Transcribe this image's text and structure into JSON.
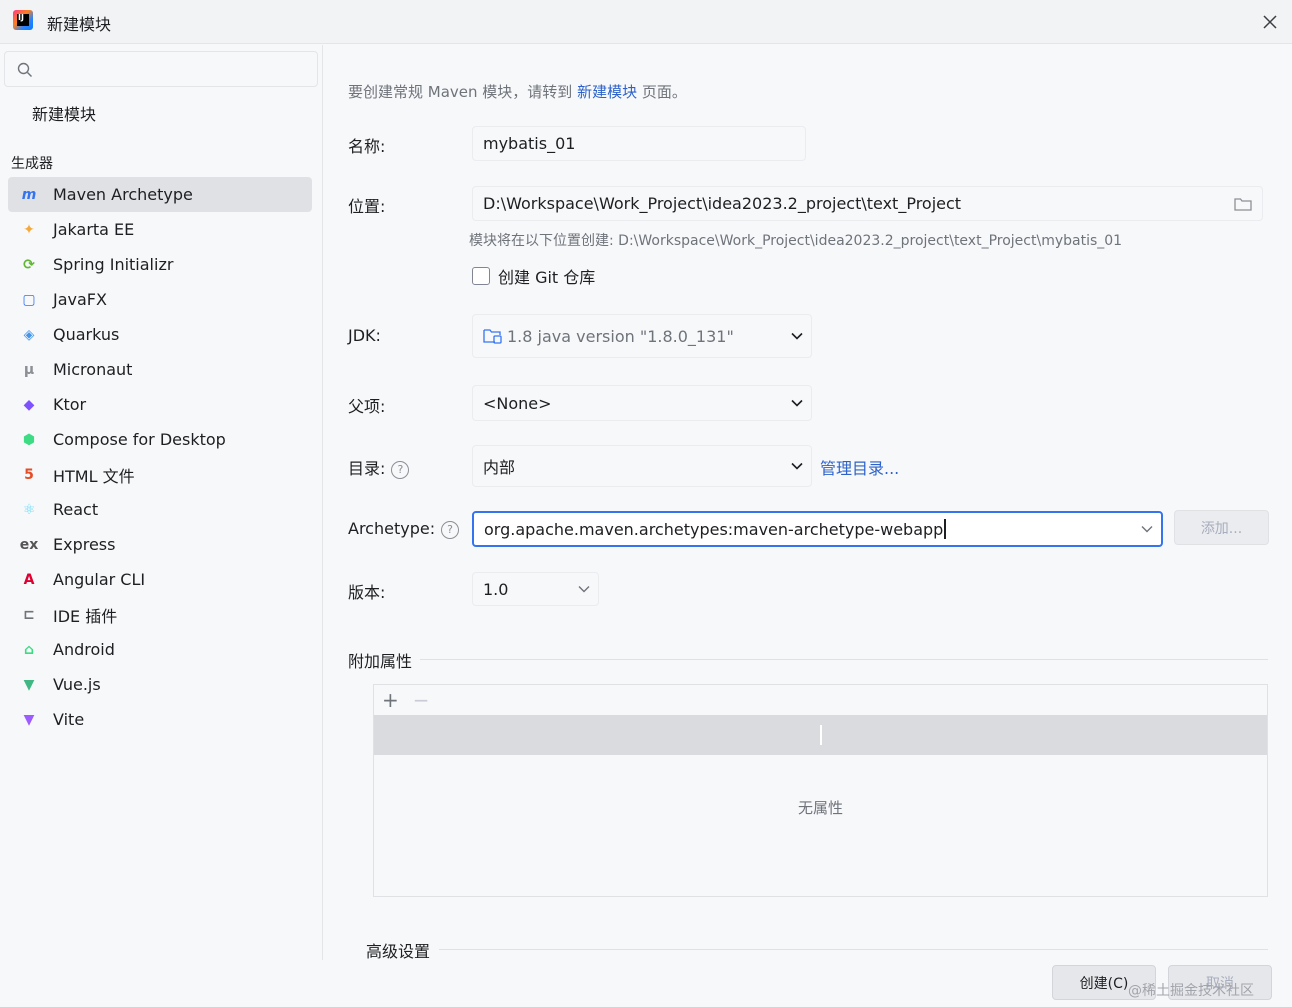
{
  "window": {
    "title": "新建模块"
  },
  "sidebar": {
    "search_placeholder": "",
    "new_module": "新建模块",
    "generators_header": "生成器",
    "items": [
      {
        "label": "Maven Archetype",
        "icon": "maven-icon",
        "color": "#3574f0",
        "selected": true
      },
      {
        "label": "Jakarta EE",
        "icon": "jakarta-icon",
        "color": "#f4a93b"
      },
      {
        "label": "Spring Initializr",
        "icon": "spring-icon",
        "color": "#5fb832"
      },
      {
        "label": "JavaFX",
        "icon": "javafx-icon",
        "color": "#3574f0"
      },
      {
        "label": "Quarkus",
        "icon": "quarkus-icon",
        "color": "#4695eb"
      },
      {
        "label": "Micronaut",
        "icon": "micronaut-icon",
        "color": "#8c8f95"
      },
      {
        "label": "Ktor",
        "icon": "ktor-icon",
        "color": "#7f52ff"
      },
      {
        "label": "Compose for Desktop",
        "icon": "compose-icon",
        "color": "#3ddc84"
      },
      {
        "label": "HTML 文件",
        "icon": "html-icon",
        "color": "#e44d26"
      },
      {
        "label": "React",
        "icon": "react-icon",
        "color": "#61dafb"
      },
      {
        "label": "Express",
        "icon": "express-icon",
        "color": "#555555"
      },
      {
        "label": "Angular CLI",
        "icon": "angular-icon",
        "color": "#dd0031"
      },
      {
        "label": "IDE 插件",
        "icon": "plugin-icon",
        "color": "#6f737a"
      },
      {
        "label": "Android",
        "icon": "android-icon",
        "color": "#3ddc84"
      },
      {
        "label": "Vue.js",
        "icon": "vue-icon",
        "color": "#41b883"
      },
      {
        "label": "Vite",
        "icon": "vite-icon",
        "color": "#9d5cff"
      }
    ]
  },
  "main": {
    "hint_prefix": "要创建常规 Maven 模块，请转到",
    "hint_link": "新建模块",
    "hint_suffix": "页面。",
    "name_label": "名称:",
    "name_value": "mybatis_01",
    "location_label": "位置:",
    "location_value": "D:\\Workspace\\Work_Project\\idea2023.2_project\\text_Project",
    "location_hint": "模块将在以下位置创建: D:\\Workspace\\Work_Project\\idea2023.2_project\\text_Project\\mybatis_01",
    "git_label": "创建 Git 仓库",
    "jdk_label": "JDK:",
    "jdk_value": "1.8 java version \"1.8.0_131\"",
    "parent_label": "父项:",
    "parent_value": "<None>",
    "catalog_label": "目录:",
    "catalog_value": "内部",
    "manage_catalogs": "管理目录...",
    "archetype_label": "Archetype:",
    "archetype_value": "org.apache.maven.archetypes:maven-archetype-webapp",
    "add_button": "添加...",
    "version_label": "版本:",
    "version_value": "1.0",
    "props_section": "附加属性",
    "props_empty": "无属性",
    "advanced_section": "高级设置"
  },
  "footer": {
    "create_button": "创建(C)",
    "cancel_button": "取消",
    "watermark": "@稀土掘金技术社区"
  },
  "help": "?"
}
